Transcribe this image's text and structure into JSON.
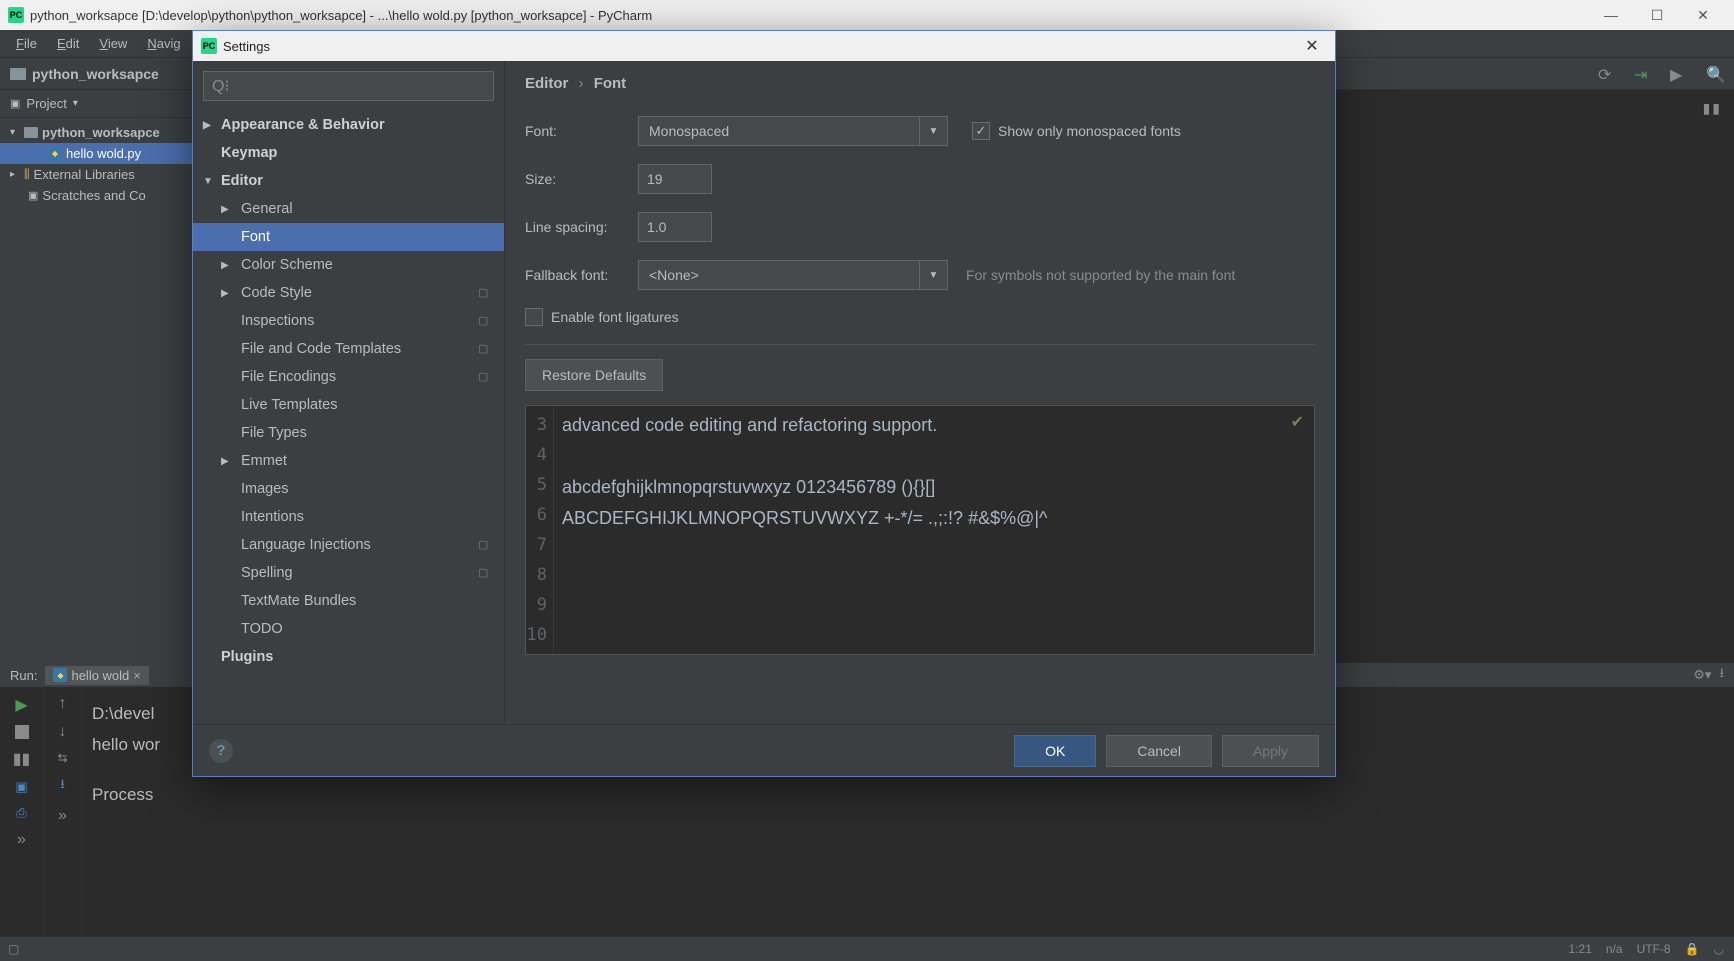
{
  "window": {
    "title": "python_worksapce [D:\\develop\\python\\python_worksapce] - ...\\hello wold.py [python_worksapce] - PyCharm"
  },
  "menu": [
    "File",
    "Edit",
    "View",
    "Navig"
  ],
  "breadcrumb": {
    "root": "python_worksapce"
  },
  "project": {
    "header": "Project",
    "tree": {
      "root": "python_worksapce",
      "file": "hello wold.py",
      "libs": "External Libraries",
      "scratch": "Scratches and Co"
    }
  },
  "run": {
    "label": "Run:",
    "tab": "hello wold",
    "out1": "D:\\devel",
    "out2": "hello wor",
    "out3": "Process "
  },
  "status": {
    "pos": "1:21",
    "ins": "n/a",
    "enc": "UTF-8"
  },
  "dialog": {
    "title": "Settings",
    "search_placeholder": "",
    "categories": {
      "appearance": "Appearance & Behavior",
      "keymap": "Keymap",
      "editor": "Editor",
      "general": "General",
      "font": "Font",
      "colors": "Color Scheme",
      "codestyle": "Code Style",
      "inspections": "Inspections",
      "filetemplates": "File and Code Templates",
      "fileenc": "File Encodings",
      "livetpl": "Live Templates",
      "filetypes": "File Types",
      "emmet": "Emmet",
      "images": "Images",
      "intentions": "Intentions",
      "langinj": "Language Injections",
      "spelling": "Spelling",
      "textmate": "TextMate Bundles",
      "todo": "TODO",
      "plugins": "Plugins"
    },
    "crumb": {
      "a": "Editor",
      "b": "Font"
    },
    "form": {
      "font_label": "Font:",
      "font_value": "Monospaced",
      "mono_label": "Show only monospaced fonts",
      "size_label": "Size:",
      "size_value": "19",
      "spacing_label": "Line spacing:",
      "spacing_value": "1.0",
      "fallback_label": "Fallback font:",
      "fallback_value": "<None>",
      "fallback_hint": "For symbols not supported by the main font",
      "ligatures_label": "Enable font ligatures",
      "restore": "Restore Defaults"
    },
    "preview": {
      "lines": [
        3,
        4,
        5,
        6,
        7,
        8,
        9,
        10
      ],
      "l3": "advanced code editing and refactoring support.",
      "l4": "",
      "l5": "abcdefghijklmnopqrstuvwxyz 0123456789 (){}[]",
      "l6": "ABCDEFGHIJKLMNOPQRSTUVWXYZ +-*/= .,;:!? #&$%@|^",
      "l7": "",
      "l8": "",
      "l9": "",
      "l10": ""
    },
    "buttons": {
      "ok": "OK",
      "cancel": "Cancel",
      "apply": "Apply"
    }
  }
}
